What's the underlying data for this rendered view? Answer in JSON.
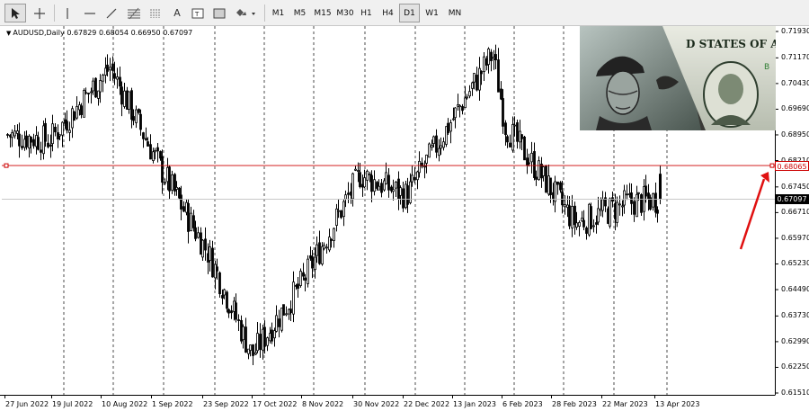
{
  "toolbar": {
    "tools": [
      "cursor-tool",
      "crosshair-tool",
      "vertical-line-tool",
      "horizontal-line-tool",
      "trendline-tool",
      "fibonacci-tool",
      "period-separator-tool",
      "text-tool",
      "text-label-tool",
      "shapes-tool"
    ],
    "timeframes": [
      {
        "label": "M1",
        "active": false
      },
      {
        "label": "M5",
        "active": false
      },
      {
        "label": "M15",
        "active": false
      },
      {
        "label": "M30",
        "active": false
      },
      {
        "label": "H1",
        "active": false
      },
      {
        "label": "H4",
        "active": false
      },
      {
        "label": "D1",
        "active": true
      },
      {
        "label": "W1",
        "active": false
      },
      {
        "label": "MN",
        "active": false
      }
    ]
  },
  "chart": {
    "symbol": "AUDUSD,Daily",
    "ohlc": "0.67829 0.68054 0.66950 0.67097",
    "price_ticks": [
      "0.71930",
      "0.71170",
      "0.70430",
      "0.69690",
      "0.68950",
      "0.68210",
      "0.67450",
      "0.66710",
      "0.65970",
      "0.65230",
      "0.64490",
      "0.63730",
      "0.62990",
      "0.62250",
      "0.61510"
    ],
    "date_ticks": [
      "27 Jun 2022",
      "19 Jul 2022",
      "10 Aug 2022",
      "1 Sep 2022",
      "23 Sep 2022",
      "17 Oct 2022",
      "8 Nov 2022",
      "30 Nov 2022",
      "22 Dec 2022",
      "13 Jan 2023",
      "6 Feb 2023",
      "28 Feb 2023",
      "22 Mar 2023",
      "13 Apr 2023"
    ],
    "horizontal_line_price": "0.68065",
    "current_price": "0.67097",
    "colors": {
      "candle": "#000000",
      "hline": "#cc0000",
      "bid_line": "#c0c0c0",
      "arrow": "#e01010",
      "grid": "#000000"
    },
    "annotation": "red-up-arrow",
    "image_inset": "us-dollar-banknote-image"
  },
  "chart_data": {
    "type": "candlestick",
    "symbol": "AUDUSD",
    "timeframe": "Daily",
    "ylim": [
      0.6151,
      0.7193
    ],
    "x_start": "27 Jun 2022",
    "x_end": "13 Apr 2023",
    "close_path": [
      {
        "date": "27 Jun 2022",
        "close": 0.6895
      },
      {
        "date": "19 Jul 2022",
        "close": 0.688
      },
      {
        "date": "10 Aug 2022",
        "close": 0.709
      },
      {
        "date": "1 Sep 2022",
        "close": 0.68
      },
      {
        "date": "23 Sep 2022",
        "close": 0.655
      },
      {
        "date": "17 Oct 2022",
        "close": 0.626
      },
      {
        "date": "8 Nov 2022",
        "close": 0.647
      },
      {
        "date": "30 Nov 2022",
        "close": 0.678
      },
      {
        "date": "22 Dec 2022",
        "close": 0.672
      },
      {
        "date": "13 Jan 2023",
        "close": 0.698
      },
      {
        "date": "2 Feb 2023",
        "close": 0.713
      },
      {
        "date": "6 Feb 2023",
        "close": 0.692
      },
      {
        "date": "28 Feb 2023",
        "close": 0.664
      },
      {
        "date": "22 Mar 2023",
        "close": 0.67
      },
      {
        "date": "13 Apr 2023",
        "close": 0.671
      }
    ],
    "last_candle": {
      "open": 0.67829,
      "high": 0.68054,
      "low": 0.6695,
      "close": 0.67097
    },
    "hline": 0.68065,
    "grid": true
  }
}
